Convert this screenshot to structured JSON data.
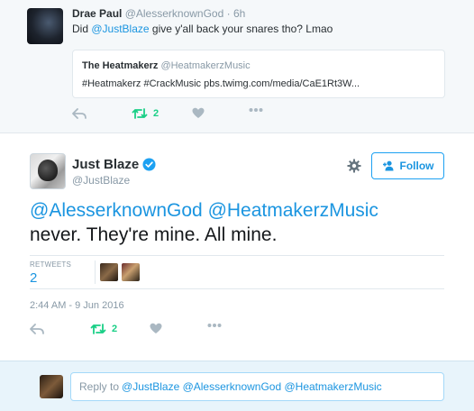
{
  "parent_tweet": {
    "author_name": "Drae Paul",
    "author_handle": "@AlesserknownGod",
    "separator": "·",
    "time": "6h",
    "text_before": "Did ",
    "mention": "@JustBlaze",
    "text_after": " give y'all back your snares tho? Lmao",
    "quote": {
      "name": "The Heatmakerz",
      "handle": "@HeatmakerzMusic",
      "text": "#Heatmakerz #CrackMusic  pbs.twimg.com/media/CaE1Rt3W..."
    },
    "actions": {
      "retweet_count": "2"
    }
  },
  "main_tweet": {
    "author_name": "Just Blaze",
    "author_handle": "@JustBlaze",
    "follow_label": "Follow",
    "mentions": "@AlesserknownGod @HeatmakerzMusic",
    "text": "never. They're mine. All mine.",
    "retweets_label": "RETWEETS",
    "retweets_count": "2",
    "timestamp": "2:44 AM - 9 Jun 2016",
    "actions": {
      "retweet_count": "2"
    }
  },
  "reply": {
    "prefix": "Reply to",
    "mentions": "@JustBlaze @AlesserknownGod @HeatmakerzMusic"
  },
  "colors": {
    "link": "#1b95e0",
    "retweet_green": "#19cf86",
    "muted": "#8899a6",
    "icon": "#aab8c2",
    "verified": "#1da1f2",
    "footer_bg": "#e8f4fb"
  },
  "icons": [
    "reply-icon",
    "retweet-icon",
    "like-icon",
    "more-icon",
    "verified-icon",
    "gear-icon",
    "follow-person-icon"
  ]
}
